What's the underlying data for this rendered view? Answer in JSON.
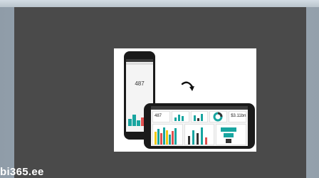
{
  "watermark": "bi365.ee",
  "phone_portrait": {
    "kpi_value": "487"
  },
  "phone_landscape": {
    "kpi_value": "487",
    "second_value": "$3.11bn"
  },
  "colors": {
    "panel": "#4a4a4a",
    "accent_teal": "#18a5a0",
    "accent_red": "#e05050",
    "accent_yellow": "#f2c811"
  },
  "icons": [
    "rotate-arrow-icon"
  ]
}
